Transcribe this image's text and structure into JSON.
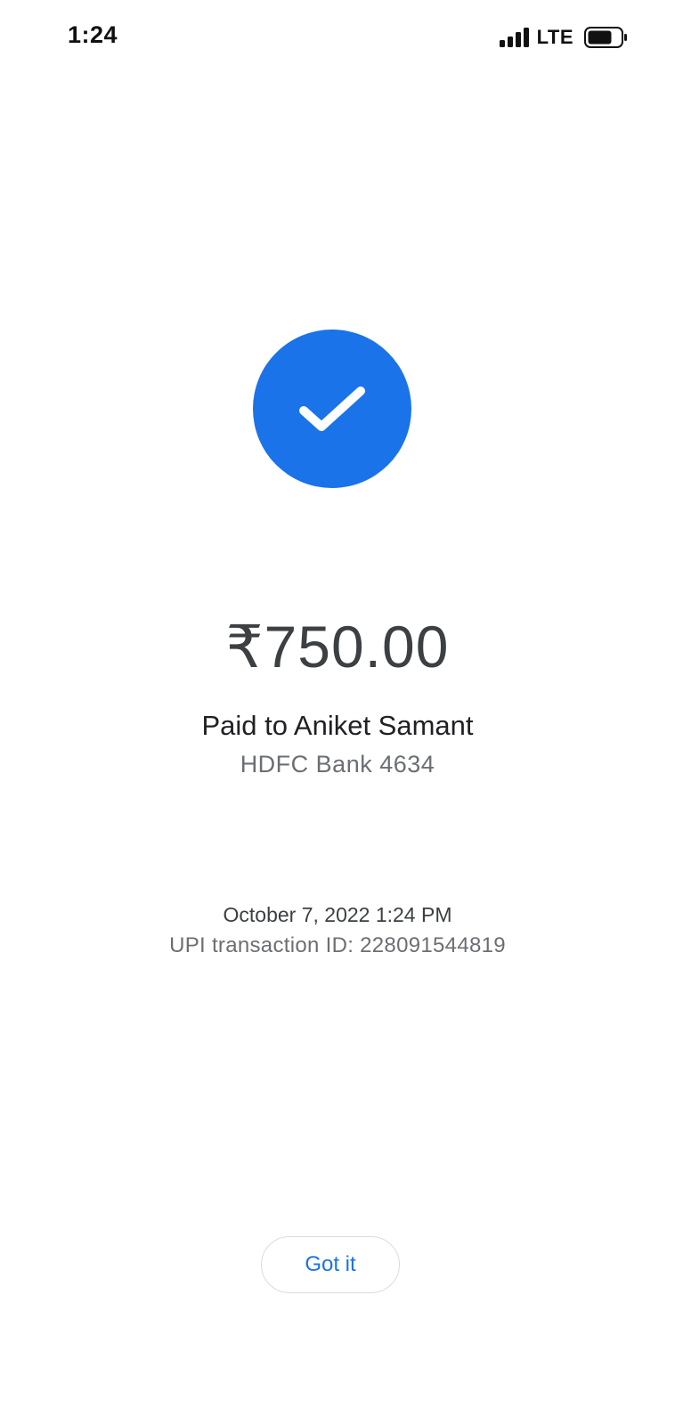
{
  "status_bar": {
    "time": "1:24",
    "network": "LTE",
    "icons": [
      "signal-bars-icon",
      "battery-icon"
    ]
  },
  "status_icon": "check-circle-icon",
  "payment": {
    "amount": "₹750.00",
    "recipient": "Paid to Aniket Samant",
    "bank": "HDFC Bank 4634",
    "datetime": "October 7, 2022 1:24 PM",
    "transaction_id": "UPI transaction ID: 228091544819"
  },
  "actions": {
    "got_it_label": "Got it"
  },
  "colors": {
    "accent": "#1a73e8",
    "primary_text": "#202124",
    "secondary_text": "#6b6f74",
    "button_border": "#dadce0",
    "background": "#ffffff"
  }
}
